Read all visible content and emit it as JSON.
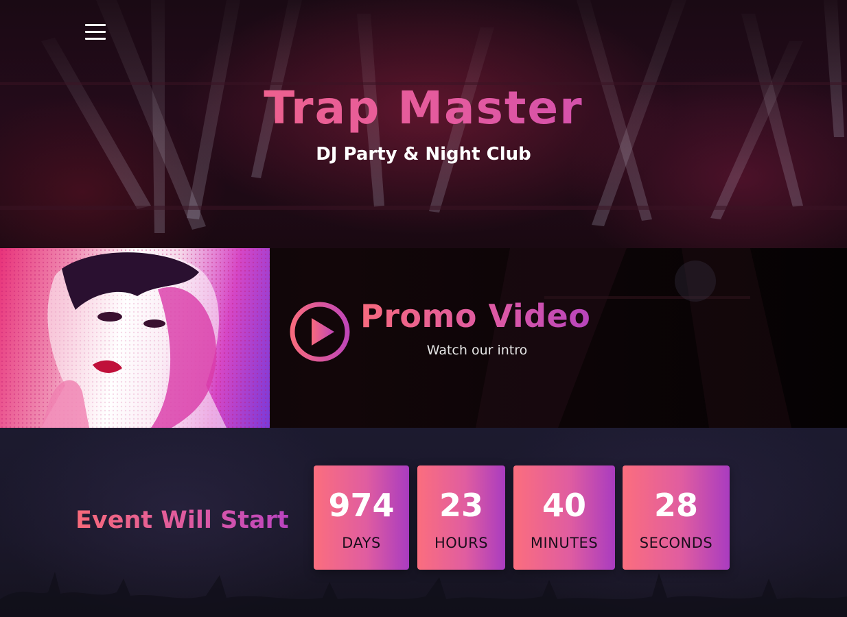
{
  "hero": {
    "title": "Trap Master",
    "subtitle": "DJ Party & Night Club"
  },
  "nav": {
    "menu_icon": "hamburger-menu-icon"
  },
  "promo": {
    "title": "Promo Video",
    "subtitle": "Watch our intro",
    "play_icon": "play-circle-icon"
  },
  "countdown": {
    "title": "Event Will Start",
    "units": [
      {
        "value": "974",
        "label": "DAYS"
      },
      {
        "value": "23",
        "label": "HOURS"
      },
      {
        "value": "40",
        "label": "MINUTES"
      },
      {
        "value": "28",
        "label": "SECONDS"
      }
    ]
  },
  "colors": {
    "accent_start": "#fb6e7e",
    "accent_mid": "#e05da0",
    "accent_end": "#a93cc0",
    "countdown_bg": "#1c1a2f"
  }
}
